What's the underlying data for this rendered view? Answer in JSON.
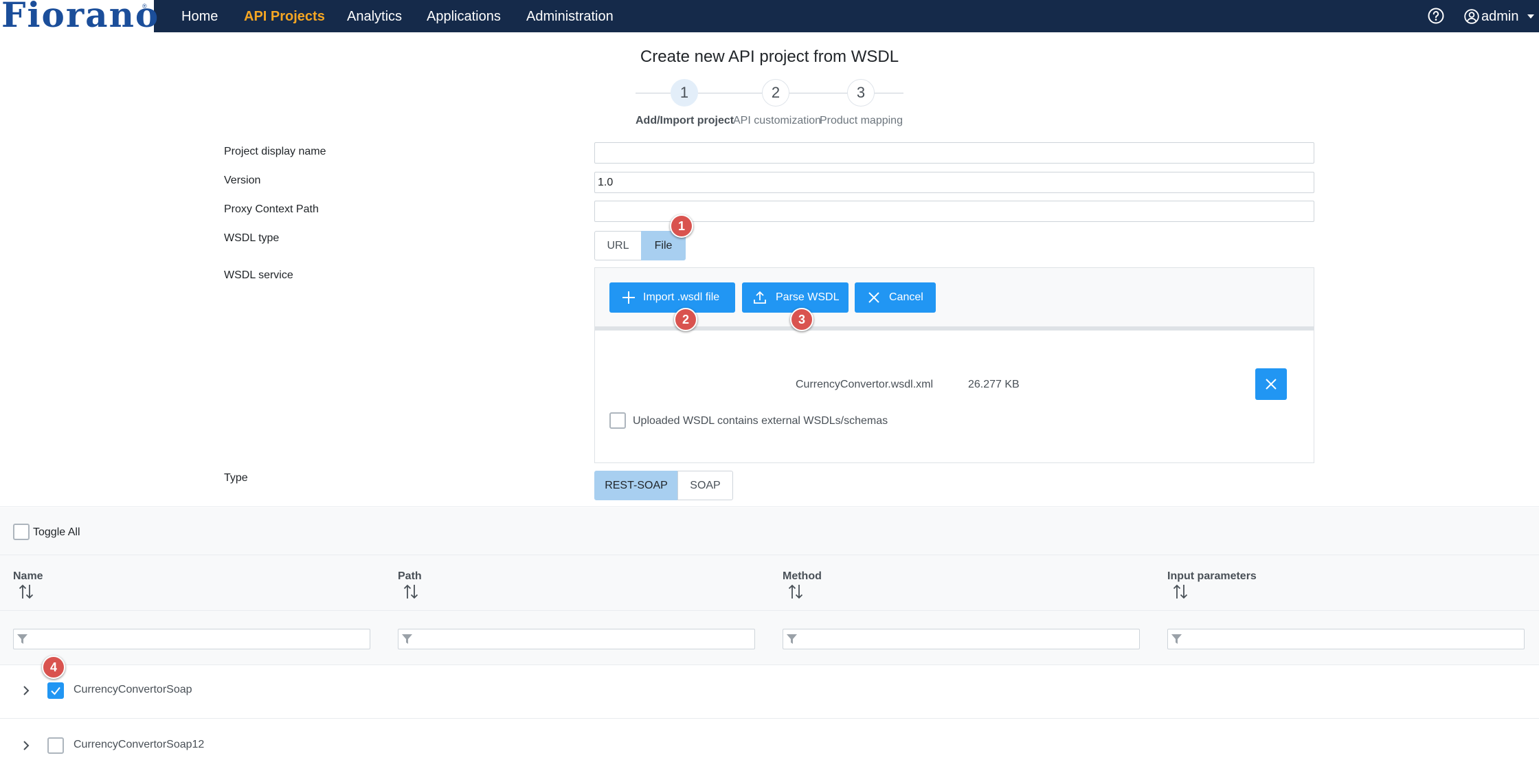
{
  "brand": {
    "logo_text": "Fiorano",
    "registered_mark": "®"
  },
  "nav": {
    "items": [
      {
        "label": "Home"
      },
      {
        "label": "API Projects"
      },
      {
        "label": "Analytics"
      },
      {
        "label": "Applications"
      },
      {
        "label": "Administration"
      }
    ],
    "active": "API Projects",
    "user": "admin",
    "help_icon": "help-circle-icon",
    "user_icon": "user-circle-icon"
  },
  "page": {
    "title": "Create new API project from WSDL"
  },
  "steps": [
    {
      "number": "1",
      "label": "Add/Import project",
      "active": true
    },
    {
      "number": "2",
      "label": "API customization",
      "active": false
    },
    {
      "number": "3",
      "label": "Product mapping",
      "active": false
    }
  ],
  "form": {
    "display_name_label": "Project display name",
    "display_name_value": "",
    "version_label": "Version",
    "version_value": "1.0",
    "context_path_label": "Proxy Context Path",
    "context_path_value": "",
    "wsdl_type_label": "WSDL type",
    "wsdl_type_options": [
      "URL",
      "File"
    ],
    "wsdl_type_selected": "File",
    "wsdl_service_label": "WSDL service",
    "type_label": "Type",
    "type_options": [
      "REST-SOAP",
      "SOAP"
    ],
    "type_selected": "REST-SOAP"
  },
  "wsdl": {
    "import_button": "Import .wsdl file",
    "parse_button": "Parse WSDL",
    "cancel_button": "Cancel",
    "file_name": "CurrencyConvertor.wsdl.xml",
    "file_size": "26.277 KB",
    "external_checkbox_label": "Uploaded WSDL contains external WSDLs/schemas",
    "external_checked": false
  },
  "callouts": [
    "1",
    "2",
    "3",
    "4"
  ],
  "table": {
    "toggle_all_label": "Toggle All",
    "columns": [
      "Name",
      "Path",
      "Method",
      "Input parameters"
    ],
    "rows": [
      {
        "name": "CurrencyConvertorSoap",
        "checked": true
      },
      {
        "name": "CurrencyConvertorSoap12",
        "checked": false
      }
    ]
  },
  "colors": {
    "navbar": "#152a4a",
    "accent": "#f5a623",
    "primary_button": "#2196f3",
    "selected_toggle": "#a8cff0",
    "callout": "#d9534f"
  }
}
